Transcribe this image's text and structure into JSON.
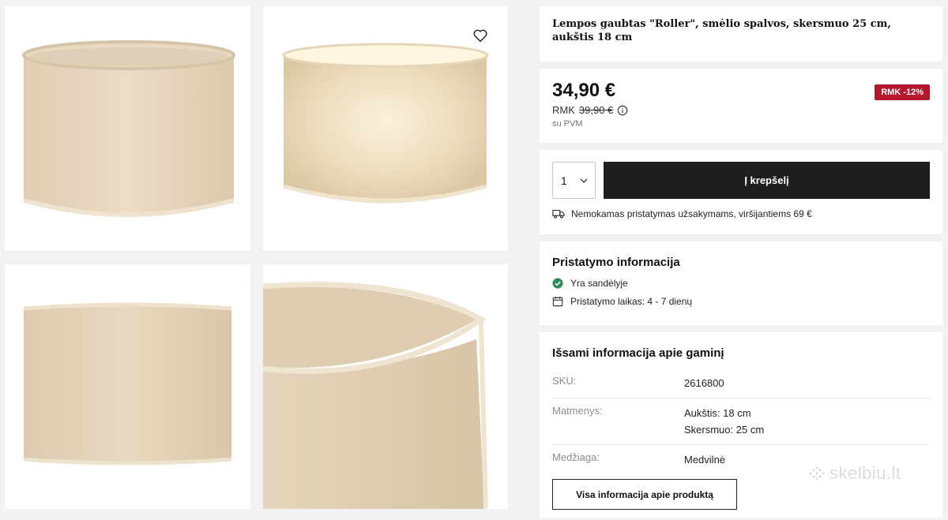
{
  "gallery": {
    "images": [
      {
        "alt": "lampshade-front"
      },
      {
        "alt": "lampshade-lit"
      },
      {
        "alt": "lampshade-side"
      },
      {
        "alt": "lampshade-closeup"
      }
    ],
    "favorite_icon": "heart-icon"
  },
  "product": {
    "title": "Lempos gaubtas \"Roller\", smėlio spalvos, skersmuo 25 cm, aukštis 18 cm"
  },
  "price": {
    "current": "34,90 €",
    "rmk_label": "RMK",
    "old": "39,90 €",
    "vat": "su PVM",
    "badge": "RMK -12%",
    "badge_color": "#b5172d"
  },
  "cart": {
    "quantity": "1",
    "add_label": "Į krepšelį",
    "shipping_text": "Nemokamas pristatymas užsakymams, viršijantiems 69 €"
  },
  "delivery": {
    "title": "Pristatymo informacija",
    "stock": "Yra sandėlyje",
    "time": "Pristatymo laikas: 4 - 7 dienų",
    "stock_color": "#2e8b57"
  },
  "details": {
    "title": "Išsami informacija apie gaminį",
    "rows": [
      {
        "key": "SKU:",
        "values": [
          "2616800"
        ]
      },
      {
        "key": "Matmenys:",
        "values": [
          "Aukštis: 18 cm",
          "Skersmuo: 25 cm"
        ]
      },
      {
        "key": "Medžiaga:",
        "values": [
          "Medvilnė"
        ]
      }
    ],
    "more_label": "Visa informacija apie produktą"
  },
  "watermark": "skelbiu.lt"
}
